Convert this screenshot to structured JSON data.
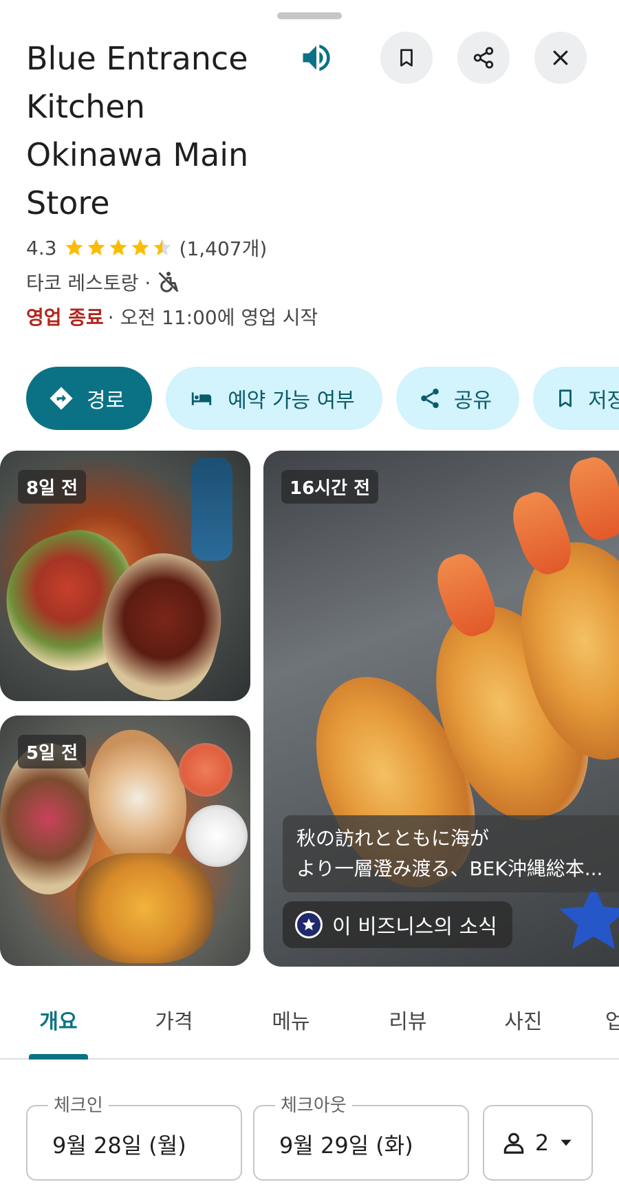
{
  "place": {
    "title": "Blue Entrance Kitchen Okinawa Main Store",
    "rating": "4.3",
    "rating_fraction": 0.86,
    "review_count": "(1,407개)",
    "category": "타코 레스토랑 ·",
    "status": "영업 종료",
    "hours_text": "· 오전 11:00에 영업 시작"
  },
  "header": {
    "speaker_icon": "volume-icon",
    "save_icon": "bookmark-icon",
    "share_icon": "share-icon",
    "close_icon": "close-icon"
  },
  "actions": [
    {
      "label": "경로",
      "icon": "directions-icon"
    },
    {
      "label": "예약 가능 여부",
      "icon": "bed-icon"
    },
    {
      "label": "공유",
      "icon": "share-icon"
    },
    {
      "label": "저장",
      "icon": "bookmark-icon"
    }
  ],
  "photos": {
    "photo1_time": "8일 전",
    "photo2_time": "5일 전",
    "photo3_time": "16시간 전",
    "photo3_caption_line1": "秋の訪れとともに海が",
    "photo3_caption_line2": "より一層澄み渡る、BEK沖縄総本...",
    "news_chip": "이 비즈니스의 소식"
  },
  "tabs": [
    {
      "label": "개요",
      "active": true
    },
    {
      "label": "가격",
      "active": false
    },
    {
      "label": "메뉴",
      "active": false
    },
    {
      "label": "리뷰",
      "active": false
    },
    {
      "label": "사진",
      "active": false
    },
    {
      "label": "업데이트",
      "active": false
    }
  ],
  "booking": {
    "checkin_label": "체크인",
    "checkin_value": "9월 28일 (월)",
    "checkout_label": "체크아웃",
    "checkout_value": "9월 29일 (화)",
    "guests": "2"
  },
  "colors": {
    "accent": "#0b7285",
    "pill_bg": "#d3f3fd",
    "star": "#fbbc04",
    "closed": "#b3261e"
  }
}
